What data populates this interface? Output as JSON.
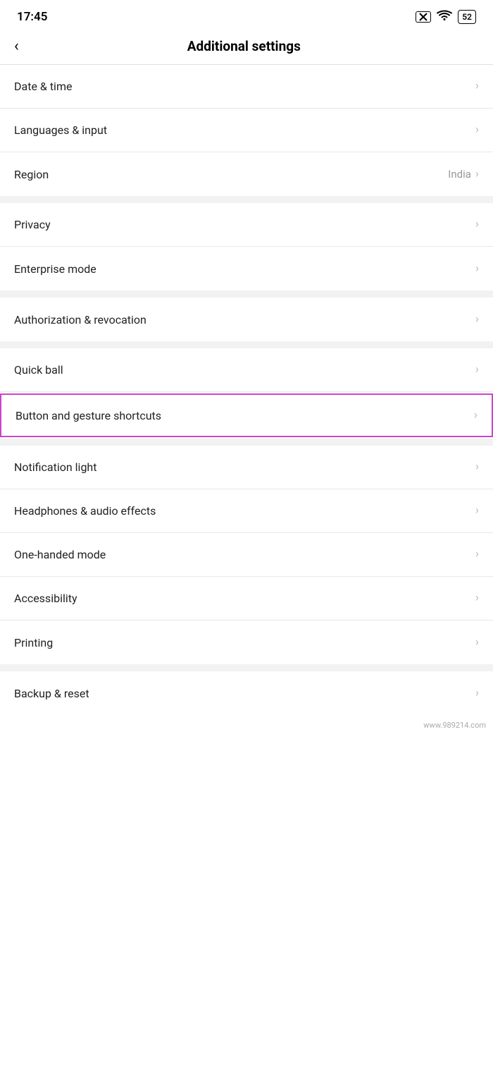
{
  "statusBar": {
    "time": "17:45",
    "batteryLevel": "52",
    "icons": {
      "close": "✕",
      "wifi": "wifi",
      "battery": "battery"
    }
  },
  "header": {
    "backLabel": "‹",
    "title": "Additional settings"
  },
  "sections": [
    {
      "id": "section1",
      "items": [
        {
          "id": "date-time",
          "label": "Date & time",
          "value": "",
          "highlighted": false
        },
        {
          "id": "languages-input",
          "label": "Languages & input",
          "value": "",
          "highlighted": false
        },
        {
          "id": "region",
          "label": "Region",
          "value": "India",
          "highlighted": false
        }
      ]
    },
    {
      "id": "section2",
      "items": [
        {
          "id": "privacy",
          "label": "Privacy",
          "value": "",
          "highlighted": false
        },
        {
          "id": "enterprise-mode",
          "label": "Enterprise mode",
          "value": "",
          "highlighted": false
        }
      ]
    },
    {
      "id": "section3",
      "items": [
        {
          "id": "authorization-revocation",
          "label": "Authorization & revocation",
          "value": "",
          "highlighted": false
        }
      ]
    },
    {
      "id": "section4",
      "items": [
        {
          "id": "quick-ball",
          "label": "Quick ball",
          "value": "",
          "highlighted": false
        },
        {
          "id": "button-gesture-shortcuts",
          "label": "Button and gesture shortcuts",
          "value": "",
          "highlighted": true
        }
      ]
    },
    {
      "id": "section5",
      "items": [
        {
          "id": "notification-light",
          "label": "Notification light",
          "value": "",
          "highlighted": false
        },
        {
          "id": "headphones-audio",
          "label": "Headphones & audio effects",
          "value": "",
          "highlighted": false
        },
        {
          "id": "one-handed-mode",
          "label": "One-handed mode",
          "value": "",
          "highlighted": false
        },
        {
          "id": "accessibility",
          "label": "Accessibility",
          "value": "",
          "highlighted": false
        },
        {
          "id": "printing",
          "label": "Printing",
          "value": "",
          "highlighted": false
        }
      ]
    },
    {
      "id": "section6",
      "items": [
        {
          "id": "backup-reset",
          "label": "Backup & reset",
          "value": "",
          "highlighted": false
        }
      ]
    }
  ],
  "watermark": {
    "text": "www.989214.com"
  }
}
